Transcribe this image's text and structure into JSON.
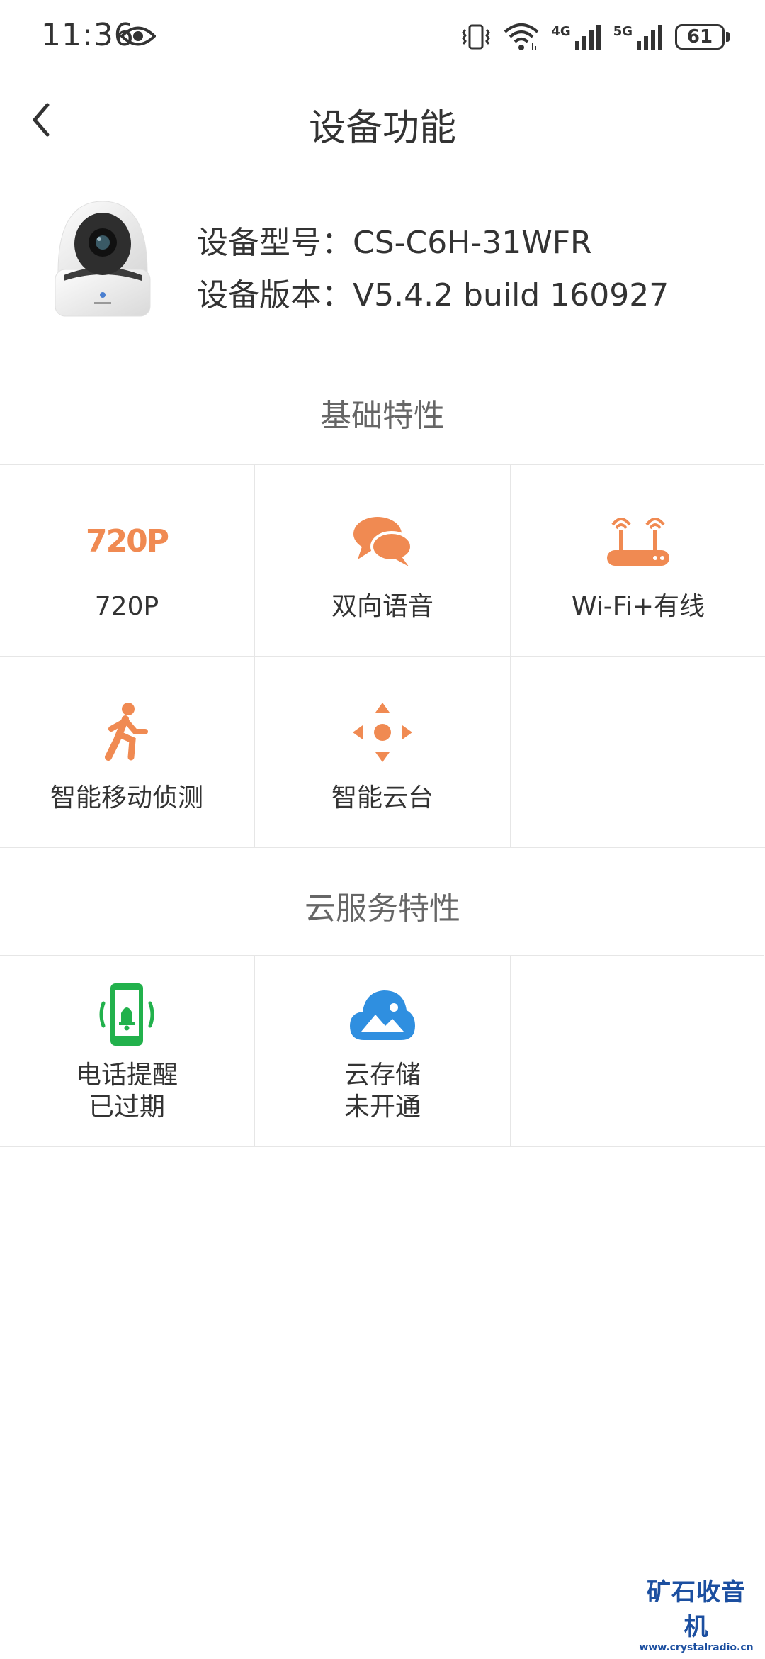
{
  "status_bar": {
    "time": "11:36",
    "net1": "4G",
    "net2": "5G",
    "battery": "61"
  },
  "header": {
    "title": "设备功能"
  },
  "device": {
    "model_label": "设备型号：",
    "model": "CS-C6H-31WFR",
    "version_label": "设备版本：",
    "version": "V5.4.2 build 160927"
  },
  "sections": {
    "basic_title": "基础特性",
    "cloud_title": "云服务特性"
  },
  "basic_features": [
    {
      "label": "720P",
      "icon": "720p-icon",
      "icon_text": "720P"
    },
    {
      "label": "双向语音",
      "icon": "chat-bubbles-icon"
    },
    {
      "label": "Wi-Fi+有线",
      "icon": "router-icon"
    },
    {
      "label": "智能移动侦测",
      "icon": "running-person-icon"
    },
    {
      "label": "智能云台",
      "icon": "ptz-arrows-icon"
    }
  ],
  "cloud_features": [
    {
      "label": "电话提醒",
      "status": "已过期",
      "icon": "phone-bell-icon"
    },
    {
      "label": "云存储",
      "status": "未开通",
      "icon": "cloud-storage-icon"
    }
  ],
  "colors": {
    "accent_orange": "#f08a52",
    "phone_green": "#22b14c",
    "cloud_blue": "#2f8fe0",
    "watermark_blue": "#1c4fa0"
  },
  "watermark": {
    "main": "矿石收音机",
    "url": "www.crystalradio.cn"
  }
}
